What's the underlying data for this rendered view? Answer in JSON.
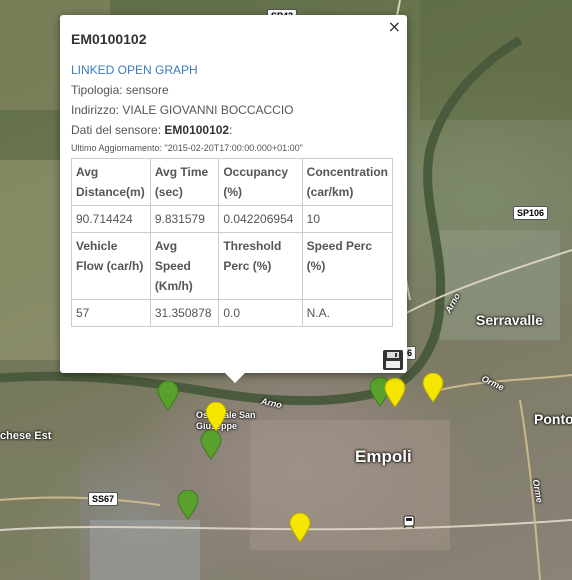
{
  "map": {
    "labels": {
      "city": "Empoli",
      "serravalle": "Serravalle",
      "ponto": "Ponto",
      "hospital": "Ospedale San Giuseppe",
      "west": "chese Est",
      "arno1": "Arno",
      "arno2": "Arno",
      "orme1": "Orme",
      "orme2": "Orme"
    },
    "road_shields": {
      "sp43": "SP43",
      "sp106": "SP106",
      "ss67": "SS67",
      "s6": "6"
    },
    "pin_colors": {
      "green": "#5aa02c",
      "yellow": "#f5e600"
    },
    "pin_icon": "map-pin-icon"
  },
  "popup": {
    "title": "EM0100102",
    "close_label": "×",
    "link_label": "LINKED OPEN GRAPH",
    "tipologia": "Tipologia: sensore",
    "indirizzo": "Indirizzo: VIALE GIOVANNI BOCCACCIO",
    "dati_prefix": "Dati del sensore: ",
    "dati_id": "EM0100102",
    "dati_suffix": ":",
    "updated": "Ultimo Aggiornamento: \"2015-02-20T17:00:00.000+01:00\"",
    "table": {
      "row1_headers": [
        "Avg Distance(m)",
        "Avg Time (sec)",
        "Occupancy (%)",
        "Concentration (car/km)"
      ],
      "row1_values": [
        "90.714424",
        "9.831579",
        "0.042206954",
        "10"
      ],
      "row2_headers": [
        "Vehicle Flow (car/h)",
        "Avg Speed (Km/h)",
        "Threshold Perc (%)",
        "Speed Perc (%)"
      ],
      "row2_values": [
        "57",
        "31.350878",
        "0.0",
        "N.A."
      ]
    },
    "save_icon": "floppy-disk-icon"
  }
}
